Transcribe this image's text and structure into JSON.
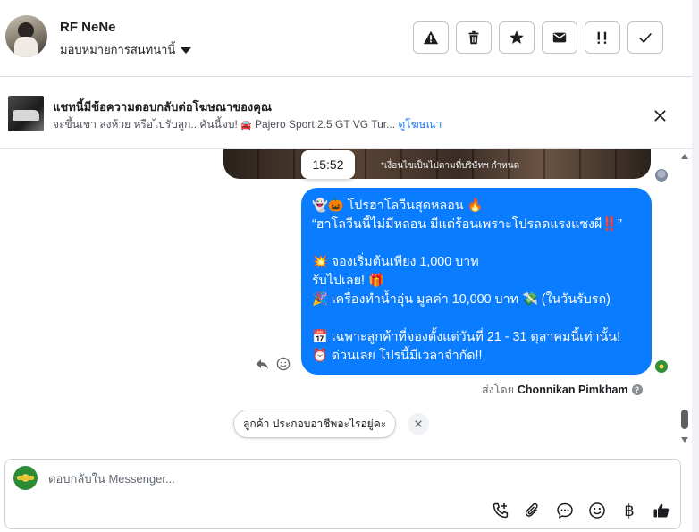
{
  "header": {
    "name": "RF NeNe",
    "assign_label": "มอบหมายการสนทนานี้",
    "tools": [
      "warning-icon",
      "trash-icon",
      "star-icon",
      "envelope-icon",
      "follow-up-icon",
      "check-icon"
    ]
  },
  "ad_bar": {
    "title": "แชทนี้มีข้อความตอบกลับต่อโฆษณาของคุณ",
    "subtitle": "จะขึ้นเขา ลงห้วย หรือไปรับลูก...คันนี้จบ!",
    "car_emoji": "🚘",
    "product": "Pajero Sport 2.5 GT VG Tur...",
    "link": "ดูโฆษณา"
  },
  "conversation": {
    "image_caption": "*เงื่อนไขเป็นไปตามที่บริษัทฯ กำหนด",
    "timestamp": "15:52",
    "message_lines": [
      "👻🎃 โปรฮาโลวีนสุดหลอน 🔥",
      "“ฮาโลวีนนี้ไม่มีหลอน มีแต่ร้อนเพราะโปรลดแรงแซงผี‼️”",
      "",
      "💥 จองเริ่มต้นเพียง 1,000 บาท",
      "รับไปเลย! 🎁",
      "🎉 เครื่องทำน้ำอุ่น มูลค่า 10,000 บาท 💸 (ในวันรับรถ)",
      "",
      "📅 เฉพาะลูกค้าที่จองตั้งแต่วันที่ 21 - 31 ตุลาคมนี้เท่านั้น!",
      "⏰ ด่วนเลย โปรนี้มีเวลาจำกัด!!"
    ],
    "sent_by_prefix": "ส่งโดย",
    "sent_by_name": "Chonnikan Pimkham",
    "suggestion_chip": "ลูกค้า ประกอบอาชีพอะไรอยู่คะ"
  },
  "composer": {
    "placeholder": "ตอบกลับใน Messenger...",
    "baht_symbol": "฿"
  },
  "colors": {
    "bubble": "#0a7cff",
    "link": "#1877f2"
  }
}
